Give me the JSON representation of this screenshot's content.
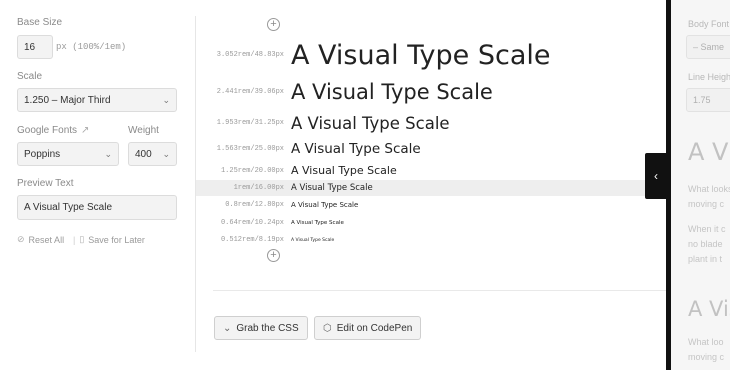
{
  "controls": {
    "base_size_label": "Base Size",
    "base_size_value": "16",
    "base_size_unit": "px (100%/1em)",
    "scale_label": "Scale",
    "scale_value": "1.250 – Major Third",
    "google_fonts_label": "Google Fonts",
    "font_value": "Poppins",
    "weight_label": "Weight",
    "weight_value": "400",
    "preview_text_label": "Preview Text",
    "preview_text_value": "A Visual Type Scale",
    "reset_label": "Reset All",
    "save_label": "Save for Later"
  },
  "scale_rows": [
    {
      "size": "3.052rem/48.83px",
      "text": "A Visual Type Scale"
    },
    {
      "size": "2.441rem/39.06px",
      "text": "A Visual Type Scale"
    },
    {
      "size": "1.953rem/31.25px",
      "text": "A Visual Type Scale"
    },
    {
      "size": "1.563rem/25.00px",
      "text": "A Visual Type Scale"
    },
    {
      "size": "1.25rem/20.00px",
      "text": "A Visual Type Scale"
    },
    {
      "size": "1rem/16.00px",
      "text": "A Visual Type Scale"
    },
    {
      "size": "0.8rem/12.80px",
      "text": "A Visual Type Scale"
    },
    {
      "size": "0.64rem/10.24px",
      "text": "A Visual Type Scale"
    },
    {
      "size": "0.512rem/8.19px",
      "text": "A Visual Type Scale"
    }
  ],
  "actions": {
    "grab_css_label": "Grab the CSS",
    "codepen_label": "Edit on CodePen"
  },
  "side_panel": {
    "body_font_label": "Body Font",
    "body_font_value": "– Same",
    "line_height_label": "Line Height",
    "line_height_value": "1.75",
    "heading_1": "A Visual",
    "para_1_line_1": "What looks",
    "para_1_line_2": "moving c",
    "para_2_line_1": "When it c",
    "para_2_line_2": "no blade",
    "para_2_line_3": "plant in t",
    "heading_2": "A Visual",
    "para_3_line_1": "What loo",
    "para_3_line_2": "moving c"
  },
  "icons": {
    "add_top": "plus-circle-icon",
    "add_bottom": "plus-circle-icon",
    "external": "external-link-icon",
    "reset": "reset-icon",
    "bookmark": "bookmark-icon",
    "chevron": "chevron-down-icon",
    "collapse": "chevron-left-icon",
    "codepen": "codepen-icon"
  }
}
